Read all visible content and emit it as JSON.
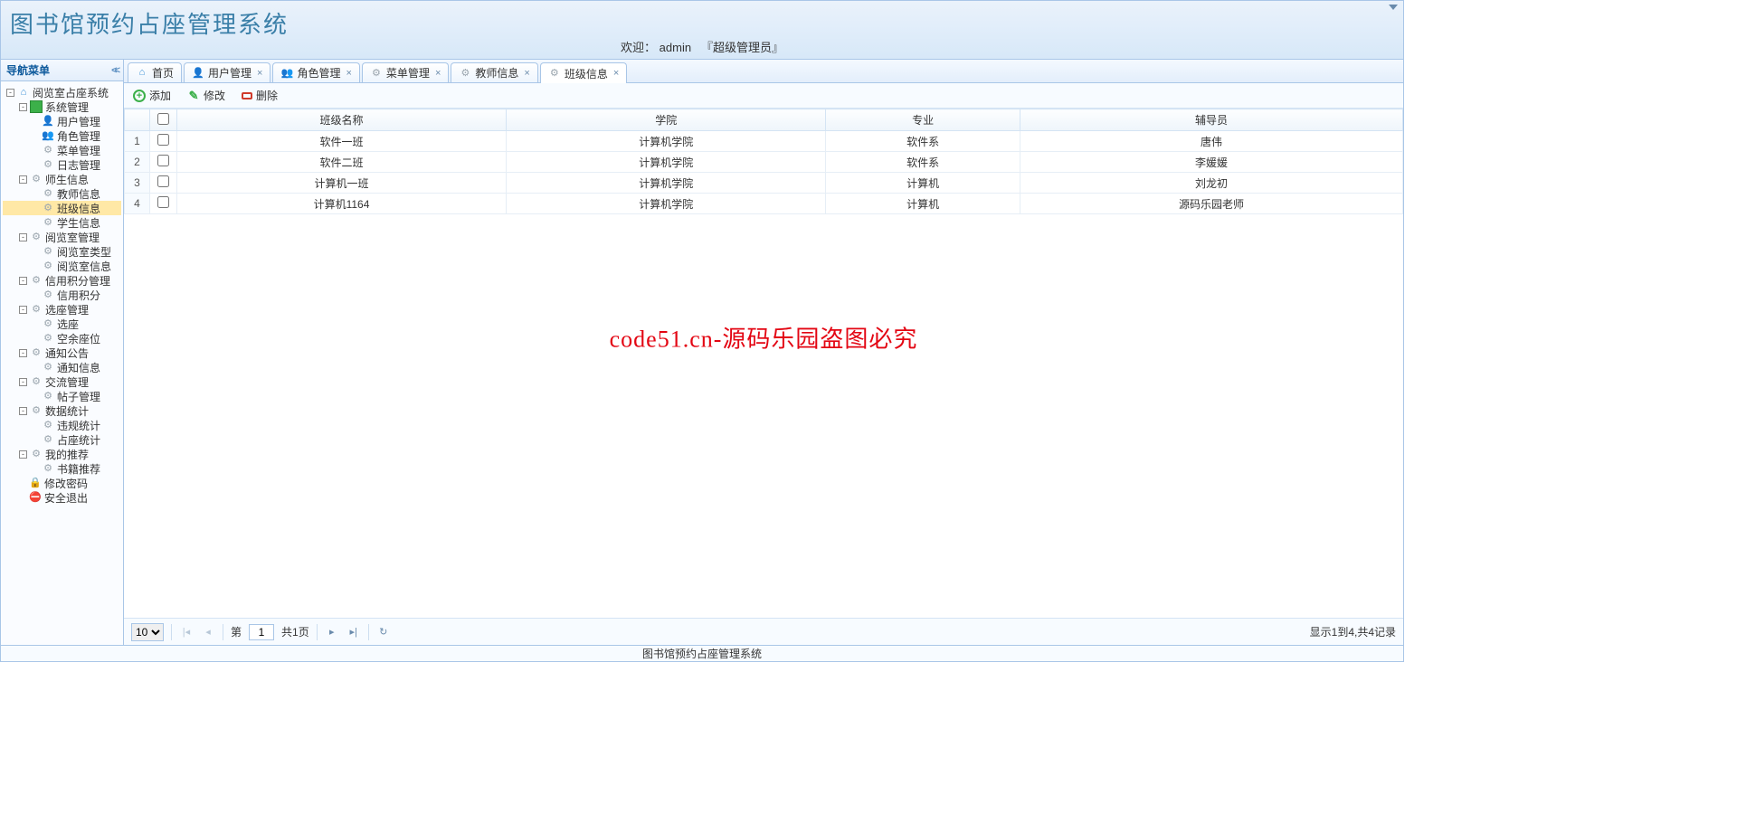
{
  "header": {
    "title": "图书馆预约占座管理系统",
    "welcome_prefix": "欢迎：",
    "username": "admin",
    "role": "『超级管理员』"
  },
  "sidebar": {
    "title": "导航菜单",
    "tree": [
      {
        "depth": 0,
        "exp": "-",
        "icon": "home",
        "label": "阅览室占座系统"
      },
      {
        "depth": 1,
        "exp": "-",
        "icon": "folder",
        "label": "系统管理"
      },
      {
        "depth": 2,
        "exp": "",
        "icon": "user",
        "label": "用户管理"
      },
      {
        "depth": 2,
        "exp": "",
        "icon": "role",
        "label": "角色管理"
      },
      {
        "depth": 2,
        "exp": "",
        "icon": "gear",
        "label": "菜单管理"
      },
      {
        "depth": 2,
        "exp": "",
        "icon": "gear",
        "label": "日志管理"
      },
      {
        "depth": 1,
        "exp": "-",
        "icon": "gear",
        "label": "师生信息"
      },
      {
        "depth": 2,
        "exp": "",
        "icon": "gear",
        "label": "教师信息"
      },
      {
        "depth": 2,
        "exp": "",
        "icon": "gear",
        "label": "班级信息",
        "selected": true
      },
      {
        "depth": 2,
        "exp": "",
        "icon": "gear",
        "label": "学生信息"
      },
      {
        "depth": 1,
        "exp": "-",
        "icon": "gear",
        "label": "阅览室管理"
      },
      {
        "depth": 2,
        "exp": "",
        "icon": "gear",
        "label": "阅览室类型"
      },
      {
        "depth": 2,
        "exp": "",
        "icon": "gear",
        "label": "阅览室信息"
      },
      {
        "depth": 1,
        "exp": "-",
        "icon": "gear",
        "label": "信用积分管理"
      },
      {
        "depth": 2,
        "exp": "",
        "icon": "gear",
        "label": "信用积分"
      },
      {
        "depth": 1,
        "exp": "-",
        "icon": "gear",
        "label": "选座管理"
      },
      {
        "depth": 2,
        "exp": "",
        "icon": "gear",
        "label": "选座"
      },
      {
        "depth": 2,
        "exp": "",
        "icon": "gear",
        "label": "空余座位"
      },
      {
        "depth": 1,
        "exp": "-",
        "icon": "gear",
        "label": "通知公告"
      },
      {
        "depth": 2,
        "exp": "",
        "icon": "gear",
        "label": "通知信息"
      },
      {
        "depth": 1,
        "exp": "-",
        "icon": "gear",
        "label": "交流管理"
      },
      {
        "depth": 2,
        "exp": "",
        "icon": "gear",
        "label": "帖子管理"
      },
      {
        "depth": 1,
        "exp": "-",
        "icon": "gear",
        "label": "数据统计"
      },
      {
        "depth": 2,
        "exp": "",
        "icon": "gear",
        "label": "违规统计"
      },
      {
        "depth": 2,
        "exp": "",
        "icon": "gear",
        "label": "占座统计"
      },
      {
        "depth": 1,
        "exp": "-",
        "icon": "gear",
        "label": "我的推荐"
      },
      {
        "depth": 2,
        "exp": "",
        "icon": "gear",
        "label": "书籍推荐"
      },
      {
        "depth": 1,
        "exp": "",
        "icon": "lock",
        "label": "修改密码"
      },
      {
        "depth": 1,
        "exp": "",
        "icon": "exit",
        "label": "安全退出"
      }
    ]
  },
  "tabs": [
    {
      "icon": "home",
      "label": "首页",
      "closable": false
    },
    {
      "icon": "user",
      "label": "用户管理",
      "closable": true
    },
    {
      "icon": "role",
      "label": "角色管理",
      "closable": true
    },
    {
      "icon": "gear",
      "label": "菜单管理",
      "closable": true
    },
    {
      "icon": "gear",
      "label": "教师信息",
      "closable": true
    },
    {
      "icon": "gear",
      "label": "班级信息",
      "closable": true,
      "active": true
    }
  ],
  "toolbar": {
    "add": "添加",
    "edit": "修改",
    "delete": "删除"
  },
  "grid": {
    "columns": [
      "班级名称",
      "学院",
      "专业",
      "辅导员"
    ],
    "rows": [
      [
        "软件一班",
        "计算机学院",
        "软件系",
        "唐伟"
      ],
      [
        "软件二班",
        "计算机学院",
        "软件系",
        "李媛媛"
      ],
      [
        "计算机一班",
        "计算机学院",
        "计算机",
        "刘龙初"
      ],
      [
        "计算机1164",
        "计算机学院",
        "计算机",
        "源码乐园老师"
      ]
    ]
  },
  "watermark": "code51.cn-源码乐园盗图必究",
  "pager": {
    "pagesize": "10",
    "page_label_prefix": "第",
    "current_page": "1",
    "total_pages_text": "共1页",
    "info": "显示1到4,共4记录"
  },
  "footer": "图书馆预约占座管理系统"
}
